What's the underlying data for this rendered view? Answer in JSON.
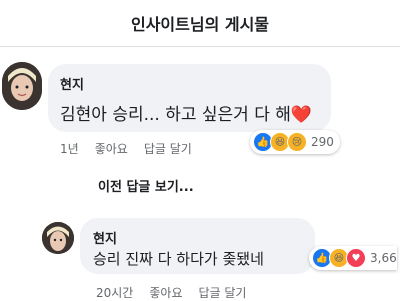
{
  "header": {
    "title": "인사이트님의 게시물"
  },
  "comment": {
    "author": "현지",
    "text": "김현아 승리... 하고 싶은거 다 해",
    "heart": "❤️",
    "time": "1년",
    "like_label": "좋아요",
    "reply_label": "답글 달기",
    "reaction_count": "290"
  },
  "more_replies": "이전 답글 보기...",
  "reply": {
    "author": "현지",
    "text": "승리 진짜 다 하다가 좆됐네",
    "time": "20시간",
    "like_label": "좋아요",
    "reply_label": "답글 달기",
    "reaction_count": "3,66"
  },
  "colors": {
    "like": "#1877f2",
    "love": "#f33e58",
    "haha": "#f7b125",
    "bubble": "#f0f2f5"
  }
}
